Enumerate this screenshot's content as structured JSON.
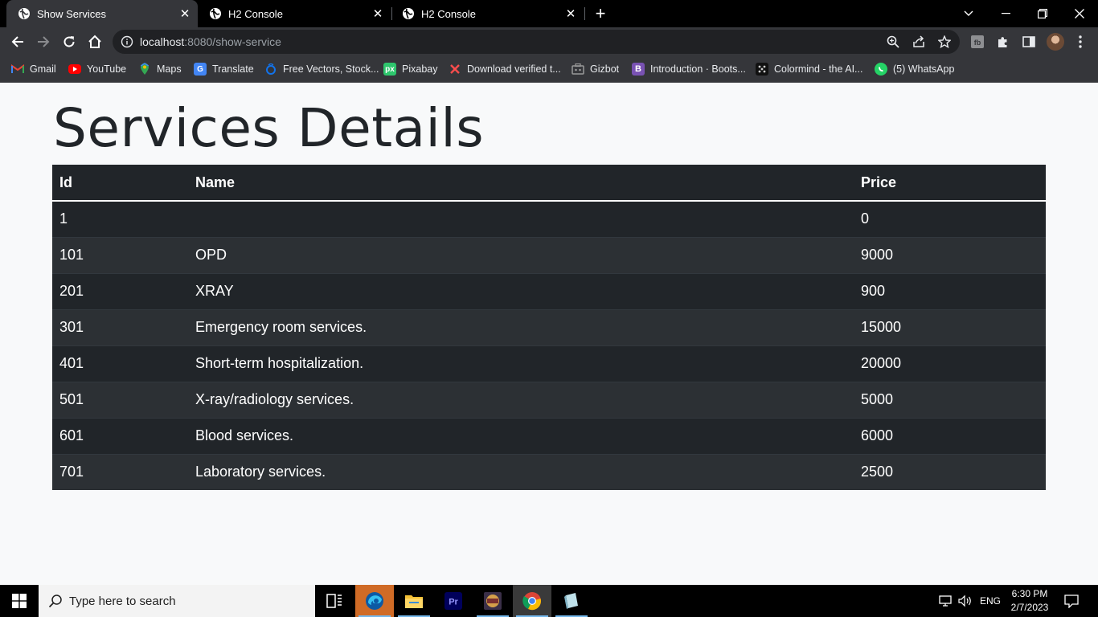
{
  "browser": {
    "tabs": [
      {
        "title": "Show Services",
        "active": true
      },
      {
        "title": "H2 Console",
        "active": false
      },
      {
        "title": "H2 Console",
        "active": false
      }
    ],
    "url_host": "localhost",
    "url_rest": ":8080/show-service",
    "bookmarks": [
      {
        "label": "Gmail",
        "icon": "gmail-icon",
        "color": "#ea4335"
      },
      {
        "label": "YouTube",
        "icon": "youtube-icon",
        "color": "#ff0000"
      },
      {
        "label": "Maps",
        "icon": "maps-icon",
        "color": "#34a853"
      },
      {
        "label": "Translate",
        "icon": "translate-icon",
        "color": "#4285f4"
      },
      {
        "label": "Free Vectors, Stock...",
        "icon": "freepik-icon",
        "color": "#1273eb"
      },
      {
        "label": "Pixabay",
        "icon": "pixabay-icon",
        "color": "#2ec66d"
      },
      {
        "label": "Download verified t...",
        "icon": "download-icon",
        "color": "#ff4d4d"
      },
      {
        "label": "Gizbot",
        "icon": "gizbot-icon",
        "color": "#8a8a8a"
      },
      {
        "label": "Introduction · Boots...",
        "icon": "bootstrap-icon",
        "color": "#7952b3"
      },
      {
        "label": "Colormind - the AI...",
        "icon": "colormind-icon",
        "color": "#222222"
      },
      {
        "label": "(5) WhatsApp",
        "icon": "whatsapp-icon",
        "color": "#25d366"
      }
    ]
  },
  "page": {
    "title": "Services Details",
    "table": {
      "headers": [
        "Id",
        "Name",
        "Price"
      ],
      "rows": [
        {
          "id": "1",
          "name": "",
          "price": "0"
        },
        {
          "id": "101",
          "name": "OPD",
          "price": "9000"
        },
        {
          "id": "201",
          "name": "XRAY",
          "price": "900"
        },
        {
          "id": "301",
          "name": "Emergency room services.",
          "price": "15000"
        },
        {
          "id": "401",
          "name": "Short-term hospitalization.",
          "price": "20000"
        },
        {
          "id": "501",
          "name": "X-ray/radiology services.",
          "price": "5000"
        },
        {
          "id": "601",
          "name": "Blood services.",
          "price": "6000"
        },
        {
          "id": "701",
          "name": "Laboratory services.",
          "price": "2500"
        }
      ]
    }
  },
  "taskbar": {
    "search_placeholder": "Type here to search",
    "language": "ENG",
    "time": "6:30 PM",
    "date": "2/7/2023"
  },
  "colors": {
    "table_bg": "#212529",
    "table_stripe": "#2c3034",
    "page_bg": "#f8f9fa"
  }
}
